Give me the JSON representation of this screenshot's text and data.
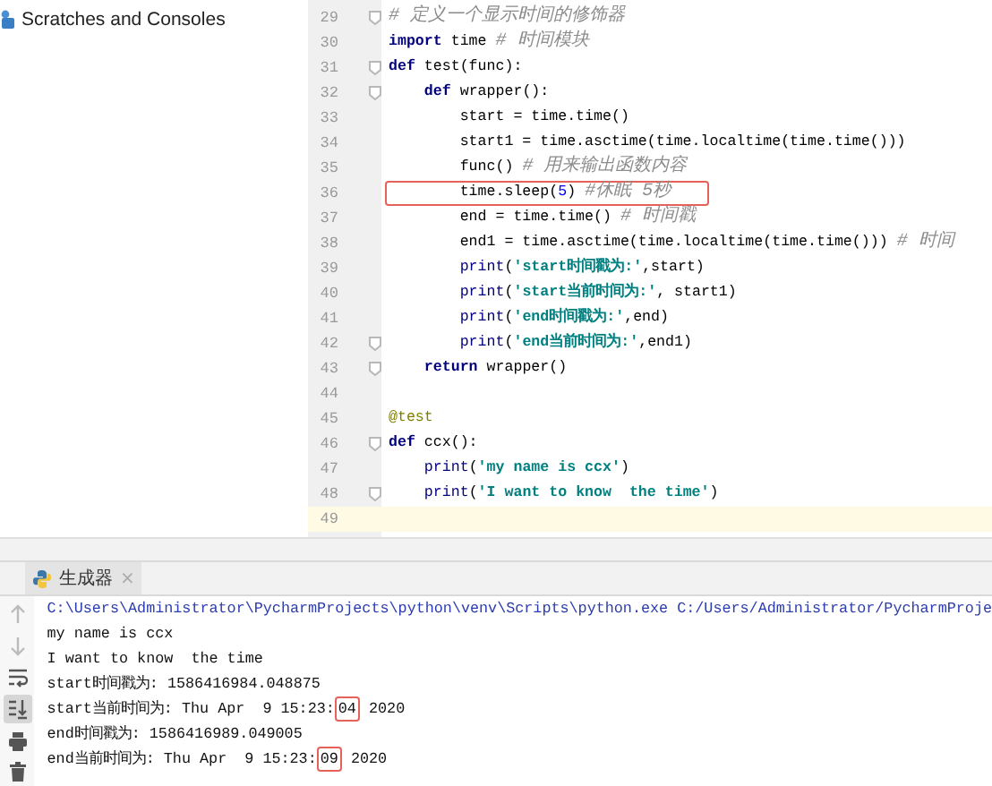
{
  "project_panel": {
    "items": [
      {
        "label": "Scratches and Consoles"
      }
    ]
  },
  "editor": {
    "lines": [
      {
        "number": "29",
        "fold": true,
        "boxed": false,
        "current": false,
        "tokens": [
          {
            "kind": "comment",
            "text": "# 定义一个显示时间的修饰器"
          }
        ]
      },
      {
        "number": "30",
        "fold": false,
        "boxed": false,
        "current": false,
        "tokens": [
          {
            "kind": "keyword",
            "text": "import"
          },
          {
            "kind": "plain",
            "text": " time "
          },
          {
            "kind": "comment",
            "text": "# 时间模块"
          }
        ]
      },
      {
        "number": "31",
        "fold": true,
        "boxed": false,
        "current": false,
        "tokens": [
          {
            "kind": "keyword",
            "text": "def"
          },
          {
            "kind": "plain",
            "text": " test(func):"
          }
        ]
      },
      {
        "number": "32",
        "fold": true,
        "boxed": false,
        "current": false,
        "tokens": [
          {
            "kind": "keyword",
            "text": "    def"
          },
          {
            "kind": "plain",
            "text": " wrapper():"
          }
        ]
      },
      {
        "number": "33",
        "fold": false,
        "boxed": false,
        "current": false,
        "tokens": [
          {
            "kind": "plain",
            "text": "        start = time.time()"
          }
        ]
      },
      {
        "number": "34",
        "fold": false,
        "boxed": false,
        "current": false,
        "tokens": [
          {
            "kind": "plain",
            "text": "        start1 = time.asctime(time.localtime(time.time()))"
          }
        ]
      },
      {
        "number": "35",
        "fold": false,
        "boxed": false,
        "current": false,
        "tokens": [
          {
            "kind": "plain",
            "text": "        func() "
          },
          {
            "kind": "comment",
            "text": "# 用来输出函数内容"
          }
        ]
      },
      {
        "number": "36",
        "fold": false,
        "boxed": true,
        "current": false,
        "tokens": [
          {
            "kind": "plain",
            "text": "        time.sleep("
          },
          {
            "kind": "number",
            "text": "5"
          },
          {
            "kind": "plain",
            "text": ") "
          },
          {
            "kind": "comment",
            "text": "#休眠 5秒"
          }
        ]
      },
      {
        "number": "37",
        "fold": false,
        "boxed": false,
        "current": false,
        "tokens": [
          {
            "kind": "plain",
            "text": "        end = time.time() "
          },
          {
            "kind": "comment",
            "text": "# 时间戳"
          }
        ]
      },
      {
        "number": "38",
        "fold": false,
        "boxed": false,
        "current": false,
        "tokens": [
          {
            "kind": "plain",
            "text": "        end1 = time.asctime(time.localtime(time.time())) "
          },
          {
            "kind": "comment",
            "text": "# 时间"
          }
        ]
      },
      {
        "number": "39",
        "fold": false,
        "boxed": false,
        "current": false,
        "tokens": [
          {
            "kind": "builtin",
            "text": "        print"
          },
          {
            "kind": "plain",
            "text": "("
          },
          {
            "kind": "string",
            "text": "'start时间戳为:'"
          },
          {
            "kind": "plain",
            "text": ",start)"
          }
        ]
      },
      {
        "number": "40",
        "fold": false,
        "boxed": false,
        "current": false,
        "tokens": [
          {
            "kind": "builtin",
            "text": "        print"
          },
          {
            "kind": "plain",
            "text": "("
          },
          {
            "kind": "string",
            "text": "'start当前时间为:'"
          },
          {
            "kind": "plain",
            "text": ", start1)"
          }
        ]
      },
      {
        "number": "41",
        "fold": false,
        "boxed": false,
        "current": false,
        "tokens": [
          {
            "kind": "builtin",
            "text": "        print"
          },
          {
            "kind": "plain",
            "text": "("
          },
          {
            "kind": "string",
            "text": "'end时间戳为:'"
          },
          {
            "kind": "plain",
            "text": ",end)"
          }
        ]
      },
      {
        "number": "42",
        "fold": true,
        "boxed": false,
        "current": false,
        "tokens": [
          {
            "kind": "builtin",
            "text": "        print"
          },
          {
            "kind": "plain",
            "text": "("
          },
          {
            "kind": "string",
            "text": "'end当前时间为:'"
          },
          {
            "kind": "plain",
            "text": ",end1)"
          }
        ]
      },
      {
        "number": "43",
        "fold": true,
        "boxed": false,
        "current": false,
        "tokens": [
          {
            "kind": "keyword",
            "text": "    return"
          },
          {
            "kind": "plain",
            "text": " wrapper()"
          }
        ]
      },
      {
        "number": "44",
        "fold": false,
        "current": false
      },
      {
        "number": "45",
        "fold": false,
        "boxed": false,
        "current": false,
        "tokens": [
          {
            "kind": "decorator",
            "text": "@test"
          }
        ]
      },
      {
        "number": "46",
        "fold": true,
        "boxed": false,
        "current": false,
        "tokens": [
          {
            "kind": "keyword",
            "text": "def"
          },
          {
            "kind": "plain",
            "text": " ccx():"
          }
        ]
      },
      {
        "number": "47",
        "fold": false,
        "boxed": false,
        "current": false,
        "tokens": [
          {
            "kind": "builtin",
            "text": "    print"
          },
          {
            "kind": "plain",
            "text": "("
          },
          {
            "kind": "string",
            "text": "'my name is ccx'"
          },
          {
            "kind": "plain",
            "text": ")"
          }
        ]
      },
      {
        "number": "48",
        "fold": true,
        "boxed": false,
        "current": false,
        "tokens": [
          {
            "kind": "builtin",
            "text": "    print"
          },
          {
            "kind": "plain",
            "text": "("
          },
          {
            "kind": "string",
            "text": "'I want to know  the time'"
          },
          {
            "kind": "plain",
            "text": ")"
          }
        ]
      },
      {
        "number": "49",
        "fold": false,
        "current": true
      }
    ]
  },
  "run_panel": {
    "tabs": [
      {
        "label": "生成器",
        "close": "×",
        "selected": true
      }
    ],
    "toolbar": [
      {
        "kind": "up",
        "disabled": true,
        "selected": false
      },
      {
        "kind": "down",
        "disabled": true,
        "selected": false
      },
      {
        "kind": "wrap",
        "disabled": false,
        "selected": false
      },
      {
        "kind": "scroll-end",
        "disabled": false,
        "selected": true
      },
      {
        "kind": "print",
        "disabled": false,
        "selected": false
      },
      {
        "kind": "trash",
        "disabled": false,
        "selected": false
      }
    ],
    "output": [
      {
        "kind": "command",
        "segments": [
          {
            "text": "C:\\Users\\Administrator\\PycharmProjects\\python\\venv\\Scripts\\python.exe C:/Users/Administrator/PycharmProje",
            "boxed": false
          }
        ]
      },
      {
        "kind": "plain",
        "segments": [
          {
            "text": "my name is ccx",
            "boxed": false
          }
        ]
      },
      {
        "kind": "plain",
        "segments": [
          {
            "text": "I want to know  the time",
            "boxed": false
          }
        ]
      },
      {
        "kind": "plain",
        "segments": [
          {
            "text": "start时间戳为: 1586416984.048875",
            "boxed": false
          }
        ]
      },
      {
        "kind": "plain",
        "segments": [
          {
            "text": "start当前时间为: Thu Apr  9 15:23:",
            "boxed": false
          },
          {
            "text": "04",
            "boxed": true
          },
          {
            "text": " 2020",
            "boxed": false
          }
        ]
      },
      {
        "kind": "plain",
        "segments": [
          {
            "text": "end时间戳为: 1586416989.049005",
            "boxed": false
          }
        ]
      },
      {
        "kind": "plain",
        "segments": [
          {
            "text": "end当前时间为: Thu Apr  9 15:23:",
            "boxed": false
          },
          {
            "text": "09",
            "boxed": true
          },
          {
            "text": " 2020",
            "boxed": false
          }
        ]
      }
    ]
  }
}
